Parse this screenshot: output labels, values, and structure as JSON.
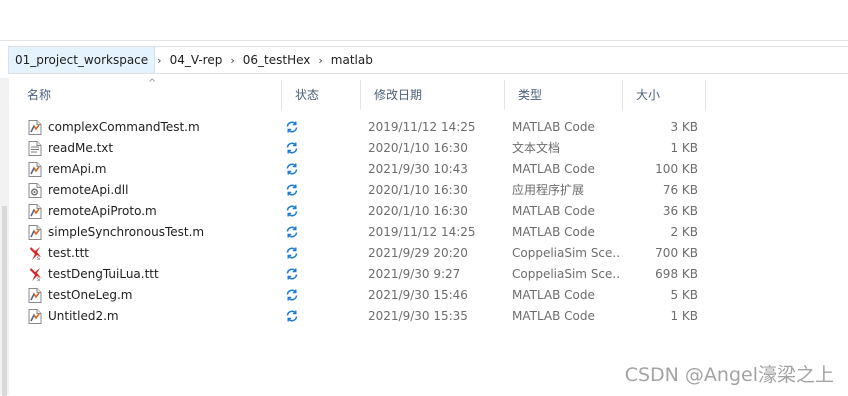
{
  "breadcrumb": [
    "01_project_workspace",
    "04_V-rep",
    "06_testHex",
    "matlab"
  ],
  "columns": {
    "name": "名称",
    "status": "状态",
    "date": "修改日期",
    "type": "类型",
    "size": "大小"
  },
  "files": [
    {
      "name": "complexCommandTest.m",
      "date": "2019/11/12 14:25",
      "type": "MATLAB Code",
      "size": "3 KB",
      "icon": "matlab-file-icon"
    },
    {
      "name": "readMe.txt",
      "date": "2020/1/10 16:30",
      "type": "文本文档",
      "size": "1 KB",
      "icon": "text-file-icon"
    },
    {
      "name": "remApi.m",
      "date": "2021/9/30 10:43",
      "type": "MATLAB Code",
      "size": "100 KB",
      "icon": "matlab-file-icon"
    },
    {
      "name": "remoteApi.dll",
      "date": "2020/1/10 16:30",
      "type": "应用程序扩展",
      "size": "76 KB",
      "icon": "dll-file-icon"
    },
    {
      "name": "remoteApiProto.m",
      "date": "2020/1/10 16:30",
      "type": "MATLAB Code",
      "size": "36 KB",
      "icon": "matlab-file-icon"
    },
    {
      "name": "simpleSynchronousTest.m",
      "date": "2019/11/12 14:25",
      "type": "MATLAB Code",
      "size": "2 KB",
      "icon": "matlab-file-icon"
    },
    {
      "name": "test.ttt",
      "date": "2021/9/29 20:20",
      "type": "CoppeliaSim Sce...",
      "size": "700 KB",
      "icon": "coppeliasim-file-icon"
    },
    {
      "name": "testDengTuiLua.ttt",
      "date": "2021/9/30 9:27",
      "type": "CoppeliaSim Sce...",
      "size": "698 KB",
      "icon": "coppeliasim-file-icon"
    },
    {
      "name": "testOneLeg.m",
      "date": "2021/9/30 15:46",
      "type": "MATLAB Code",
      "size": "5 KB",
      "icon": "matlab-file-icon"
    },
    {
      "name": "Untitled2.m",
      "date": "2021/9/30 15:35",
      "type": "MATLAB Code",
      "size": "1 KB",
      "icon": "matlab-file-icon"
    }
  ],
  "watermark": "CSDN @Angel濠梁之上",
  "colors": {
    "sync": "#1e7bd6",
    "breadcrumb_active": "#e5f3ff",
    "header_text": "#4c607a"
  }
}
